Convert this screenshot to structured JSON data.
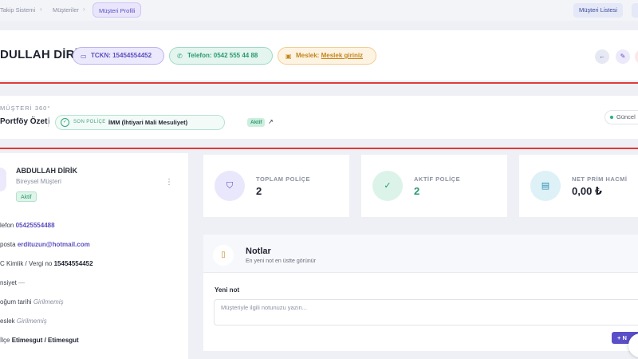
{
  "breadcrumb": {
    "items": [
      "Takip Sistemi",
      "Müşteriler"
    ],
    "active": "Müşteri Profili"
  },
  "top_actions": {
    "customer_list": "Müşteri Listesi"
  },
  "header": {
    "name": "DULLAH DİRİK",
    "tckn_label": "TCKN: 15454554452",
    "phone_label": "Telefon: 0542 555 44 88",
    "job_prefix": "Meslek:",
    "job_link": "Meslek giriniz"
  },
  "overview": {
    "section_label": "MÜŞTERİ 360°",
    "title": "Portföy Özeti",
    "last_policy_tag": "SON POLİÇE",
    "last_policy_name": "İMM (İhtiyari Mali Mesuliyet)",
    "last_policy_status": "Aktif",
    "updated_label": "Güncel"
  },
  "profile": {
    "name": "ABDULLAH DİRİK",
    "type": "Bireysel Müşteri",
    "status": "Aktif",
    "fields": [
      {
        "label": "lefon",
        "value": "05425554488",
        "style": "link"
      },
      {
        "label": "posta",
        "value": "erdituzun@hotmail.com",
        "style": "link"
      },
      {
        "label": "C Kimlik / Vergi no",
        "value": "15454554452",
        "style": "bold"
      },
      {
        "label": "nsiyet",
        "value": "—",
        "style": "muted-plain"
      },
      {
        "label": "oğum tarihi",
        "value": "Girilmemiş",
        "style": "muted"
      },
      {
        "label": "eslek",
        "value": "Girilmemiş",
        "style": "muted"
      },
      {
        "label": "İlçe",
        "value": "Etimesgut / Etimesgut",
        "style": "bold"
      }
    ]
  },
  "stats": [
    {
      "label": "TOPLAM POLİÇE",
      "value": "2",
      "value_color": "#1f2330",
      "icon": "shield-icon",
      "icon_bg": "#e9e7fb",
      "icon_color": "#5a4fc0"
    },
    {
      "label": "AKTİF POLİÇE",
      "value": "2",
      "value_color": "#2a9a70",
      "icon": "check-circle-icon",
      "icon_bg": "#dcf3ea",
      "icon_color": "#2a9a70"
    },
    {
      "label": "NET PRİM HACMİ",
      "value": "0,00 ₺",
      "value_color": "#1f2330",
      "icon": "wallet-icon",
      "icon_bg": "#ddf1f7",
      "icon_color": "#2e8fb0"
    }
  ],
  "notes": {
    "title": "Notlar",
    "subtitle": "En yeni not en üstte görünür",
    "new_label": "Yeni not",
    "placeholder": "Müşteriyle ilgili notunuzu yazın...",
    "add_button": "+ N"
  },
  "colors": {
    "accent": "#5b4fc9",
    "success": "#2a9a70",
    "warning": "#c4851d",
    "highlight_line": "#e03a3a"
  }
}
